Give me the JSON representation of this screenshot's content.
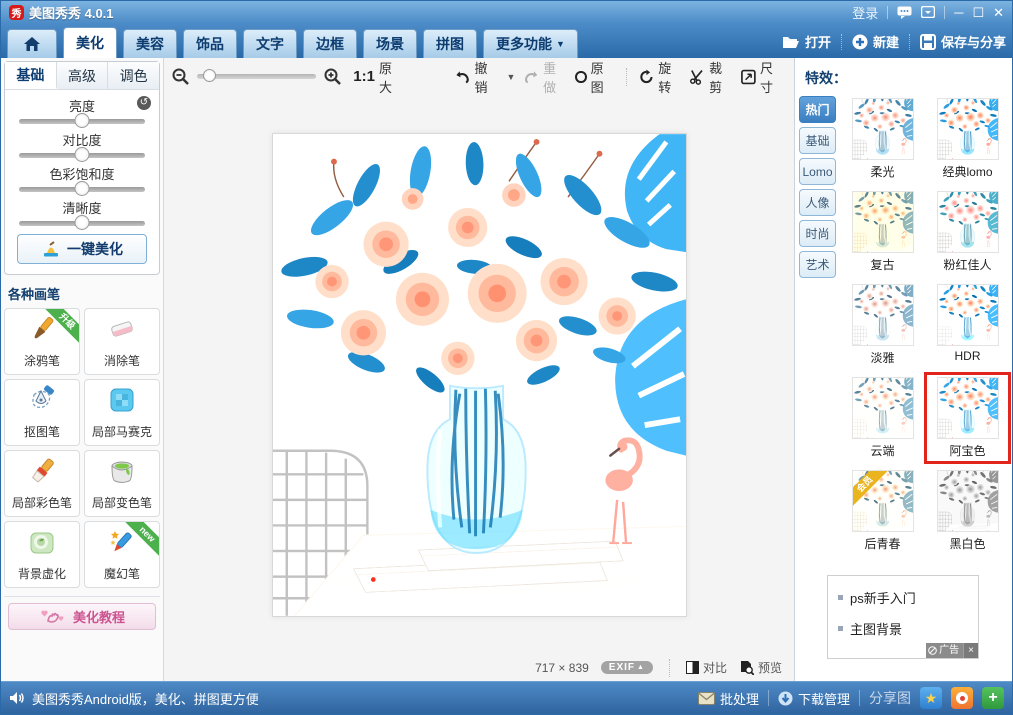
{
  "titlebar": {
    "app_title": "美图秀秀 4.0.1",
    "logo_glyph": "秀",
    "login_label": "登录"
  },
  "navbar": {
    "tabs": [
      {
        "label": "美化",
        "active": true
      },
      {
        "label": "美容"
      },
      {
        "label": "饰品"
      },
      {
        "label": "文字"
      },
      {
        "label": "边框"
      },
      {
        "label": "场景"
      },
      {
        "label": "拼图"
      },
      {
        "label": "更多功能",
        "dropdown": true
      }
    ],
    "open_label": "打开",
    "new_label": "新建",
    "save_label": "保存与分享"
  },
  "toolbar": {
    "zoom_ratio": "1:1",
    "zoom_fit": "原大",
    "undo_label": "撤销",
    "redo_label": "重做",
    "original_label": "原图",
    "rotate_label": "旋转",
    "crop_label": "裁剪",
    "resize_label": "尺寸"
  },
  "adjust_panel": {
    "tabs": [
      {
        "label": "基础",
        "active": true
      },
      {
        "label": "高级"
      },
      {
        "label": "调色"
      }
    ],
    "sliders": [
      {
        "label": "亮度",
        "value": 50
      },
      {
        "label": "对比度",
        "value": 50
      },
      {
        "label": "色彩饱和度",
        "value": 50
      },
      {
        "label": "清晰度",
        "value": 50
      }
    ],
    "one_click_label": "一键美化"
  },
  "brushes": {
    "title": "各种画笔",
    "items": [
      {
        "label": "涂鸦笔",
        "icon": "doodle-pen-icon",
        "badge": "升级",
        "badge_color": "#4cb04c",
        "badge_side": "right"
      },
      {
        "label": "消除笔",
        "icon": "eraser-icon"
      },
      {
        "label": "抠图笔",
        "icon": "cutout-pen-icon"
      },
      {
        "label": "局部马赛克",
        "icon": "mosaic-icon"
      },
      {
        "label": "局部彩色笔",
        "icon": "color-brush-icon"
      },
      {
        "label": "局部变色笔",
        "icon": "recolor-bucket-icon"
      },
      {
        "label": "背景虚化",
        "icon": "background-blur-icon"
      },
      {
        "label": "魔幻笔",
        "icon": "magic-pen-icon",
        "badge": "new",
        "badge_color": "#4cb04c",
        "badge_side": "right"
      }
    ]
  },
  "tutorial_button_label": "美化教程",
  "canvas": {
    "image_size": "717 × 839",
    "exif_label": "EXIF",
    "compare_label": "对比",
    "preview_label": "预览"
  },
  "effects_panel": {
    "title": "特效：",
    "categories": [
      {
        "label": "热门",
        "active": true
      },
      {
        "label": "基础"
      },
      {
        "label": "Lomo"
      },
      {
        "label": "人像"
      },
      {
        "label": "时尚"
      },
      {
        "label": "艺术"
      }
    ],
    "items": [
      {
        "name": "柔光"
      },
      {
        "name": "经典lomo"
      },
      {
        "name": "复古"
      },
      {
        "name": "粉红佳人"
      },
      {
        "name": "淡雅"
      },
      {
        "name": "HDR"
      },
      {
        "name": "云端"
      },
      {
        "name": "阿宝色",
        "selected": true
      },
      {
        "name": "后青春",
        "badge": "会员",
        "badge_color": "#e9b41e"
      },
      {
        "name": "黑白色"
      }
    ]
  },
  "ad_box": {
    "links": [
      "ps新手入门",
      "主图背景"
    ],
    "ad_label": "广告",
    "close_label": "×"
  },
  "statusbar": {
    "message": "美图秀秀Android版，美化、拼图更方便",
    "batch_label": "批处理",
    "download_label": "下载管理",
    "share_label": "分享图"
  },
  "colors": {
    "accent_blue": "#3a7fc0",
    "selected_red": "#e1251b",
    "ribbon_green": "#4cb04c",
    "ribbon_gold": "#e9b41e",
    "logo_red": "#d61a1a"
  }
}
